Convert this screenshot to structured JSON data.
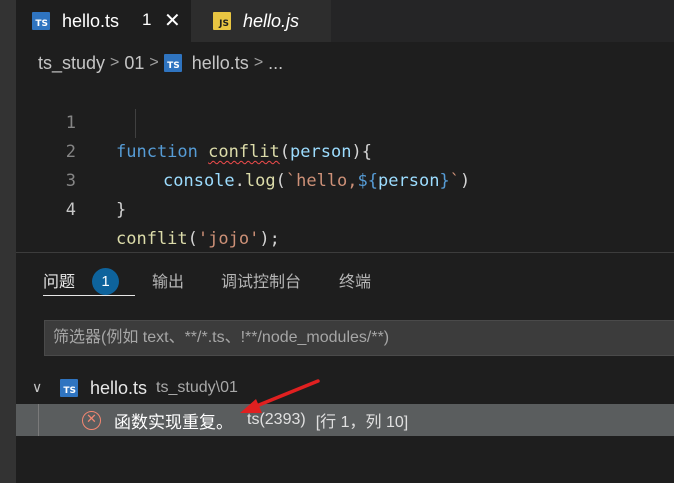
{
  "tabs": [
    {
      "label": "hello.ts",
      "icon": "TS",
      "problem_count": "1",
      "close": "✕",
      "active": true
    },
    {
      "label": "hello.js",
      "icon": "JS",
      "active": false
    }
  ],
  "breadcrumb": {
    "folder": "ts_study",
    "subfolder": "01",
    "file": "hello.ts",
    "more": "..."
  },
  "editor": {
    "lines": [
      {
        "number": "1",
        "text": "function conflit(person){"
      },
      {
        "number": "2",
        "text": "    console.log(`hello,${person}`)"
      },
      {
        "number": "3",
        "text": "}"
      },
      {
        "number": "4",
        "text": "conflit('jojo');"
      }
    ],
    "tokens": {
      "function_kw": "function",
      "fn_name": "conflit",
      "param_open": "(",
      "param": "person",
      "param_close": "){",
      "console": "console",
      "dot": ".",
      "log": "log",
      "call_open": "(",
      "template": "`hello,",
      "interp_open": "${",
      "interp_var": "person",
      "interp_close": "}",
      "template_end": "`",
      "call_close": ")",
      "brace_close": "}",
      "call_fn": "conflit",
      "arg_open": "(",
      "arg": "'jojo'",
      "arg_close": ");"
    }
  },
  "panel": {
    "tabs": [
      "问题",
      "输出",
      "调试控制台",
      "终端"
    ],
    "problem_badge": "1",
    "filter_placeholder": "筛选器(例如 text、**/*.ts、!**/node_modules/**)",
    "file": {
      "name": "hello.ts",
      "path": "ts_study\\01"
    },
    "error": {
      "message": "函数实现重复。",
      "code": "ts(2393)",
      "position": "[行 1，列 10]"
    }
  },
  "colors": {
    "accent": "#0e639c",
    "error": "#f48771",
    "annotation_arrow": "#e02020"
  }
}
